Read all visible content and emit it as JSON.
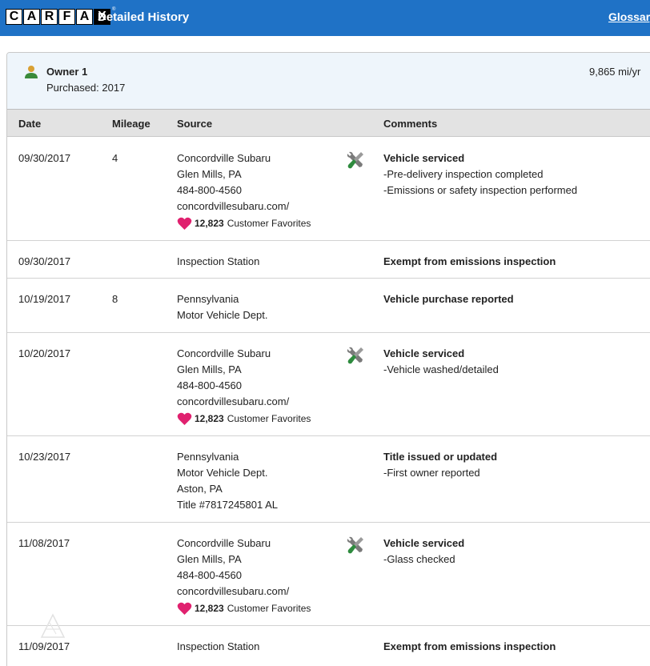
{
  "header": {
    "logo_letters": [
      "C",
      "A",
      "R",
      "F",
      "A",
      "X"
    ],
    "title": "Detailed History",
    "glossary_link": "Glossary"
  },
  "owner": {
    "title": "Owner 1",
    "purchased": "Purchased: 2017",
    "miles_per_year": "9,865 mi/yr"
  },
  "columns": {
    "date": "Date",
    "mileage": "Mileage",
    "source": "Source",
    "comments": "Comments"
  },
  "favorites": {
    "count": "12,823",
    "label": "Customer Favorites"
  },
  "rows": [
    {
      "date": "09/30/2017",
      "mileage": "4",
      "source": [
        "Concordville Subaru",
        "Glen Mills, PA",
        "484-800-4560",
        "concordvillesubaru.com/"
      ],
      "comment_head": "Vehicle serviced",
      "comment_items": [
        "Pre-delivery inspection completed",
        "Emissions or safety inspection performed"
      ]
    },
    {
      "date": "09/30/2017",
      "mileage": "",
      "source": [
        "Inspection Station"
      ],
      "comment_head": "Exempt from emissions inspection",
      "comment_items": []
    },
    {
      "date": "10/19/2017",
      "mileage": "8",
      "source": [
        "Pennsylvania",
        "Motor Vehicle Dept."
      ],
      "comment_head": "Vehicle purchase reported",
      "comment_items": []
    },
    {
      "date": "10/20/2017",
      "mileage": "",
      "source": [
        "Concordville Subaru",
        "Glen Mills, PA",
        "484-800-4560",
        "concordvillesubaru.com/"
      ],
      "comment_head": "Vehicle serviced",
      "comment_items": [
        "Vehicle washed/detailed"
      ]
    },
    {
      "date": "10/23/2017",
      "mileage": "",
      "source": [
        "Pennsylvania",
        "Motor Vehicle Dept.",
        "Aston, PA",
        "Title #7817245801 AL"
      ],
      "comment_head": "Title issued or updated",
      "comment_items": [
        "First owner reported"
      ]
    },
    {
      "date": "11/08/2017",
      "mileage": "",
      "source": [
        "Concordville Subaru",
        "Glen Mills, PA",
        "484-800-4560",
        "concordvillesubaru.com/"
      ],
      "comment_head": "Vehicle serviced",
      "comment_items": [
        "Glass checked"
      ]
    },
    {
      "date": "11/09/2017",
      "mileage": "",
      "source": [
        "Inspection Station"
      ],
      "comment_head": "Exempt from emissions inspection",
      "comment_items": []
    }
  ],
  "colors": {
    "header_bg": "#1f72c6",
    "owner_bg": "#eef5fb",
    "column_header_bg": "#e3e3e3",
    "heart": "#e0216f",
    "owner_icon": "#3a8a3a",
    "wrench_green": "#2e8b3e"
  },
  "icons": {
    "owner": "person-icon",
    "service": "wrench-screwdriver-icon",
    "favorite": "heart-icon"
  }
}
